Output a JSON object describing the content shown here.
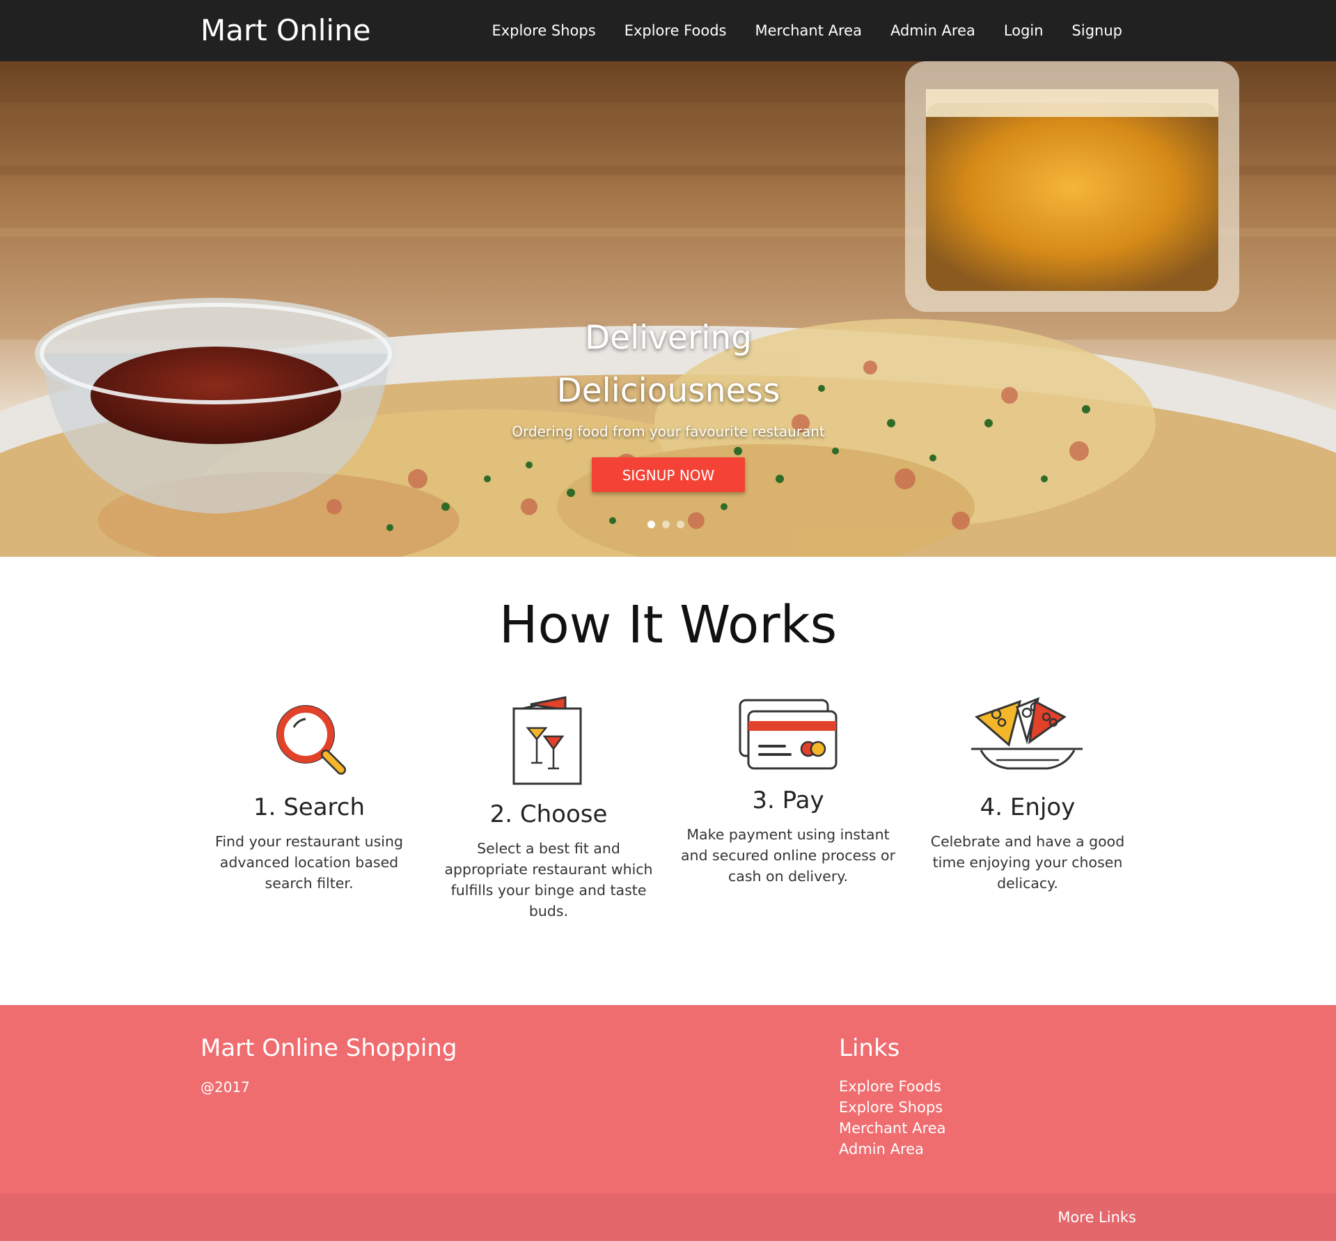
{
  "navbar": {
    "brand": "Mart Online",
    "links": [
      "Explore Shops",
      "Explore Foods",
      "Merchant Area",
      "Admin Area",
      "Login",
      "Signup"
    ]
  },
  "hero": {
    "title_line1": "Delivering",
    "title_line2": "Deliciousness",
    "subtitle": "Ordering food from your favourite restaurant",
    "button": "SIGNUP NOW",
    "slide_count": 3,
    "active_slide": 1
  },
  "how_it_works": {
    "title": "How It Works",
    "steps": [
      {
        "title": "1. Search",
        "text": "Find your restaurant using advanced location based search filter.",
        "icon": "magnifier-icon"
      },
      {
        "title": "2. Choose",
        "text": "Select a best fit and appropriate restaurant which fulfills your binge and taste buds.",
        "icon": "menu-card-icon"
      },
      {
        "title": "3. Pay",
        "text": "Make payment using instant and secured online process or cash on delivery.",
        "icon": "credit-card-icon"
      },
      {
        "title": "4. Enjoy",
        "text": "Celebrate and have a good time enjoying your chosen delicacy.",
        "icon": "food-plate-icon"
      }
    ]
  },
  "footer": {
    "title": "Mart Online Shopping",
    "copyright": "@2017",
    "links_title": "Links",
    "links": [
      "Explore Foods",
      "Explore Shops",
      "Merchant Area",
      "Admin Area"
    ],
    "more_links": "More Links"
  },
  "colors": {
    "navbar": "#212121",
    "accent": "#f44336",
    "footer": "#ef6c6f",
    "footer_bottom": "#e3676b"
  }
}
